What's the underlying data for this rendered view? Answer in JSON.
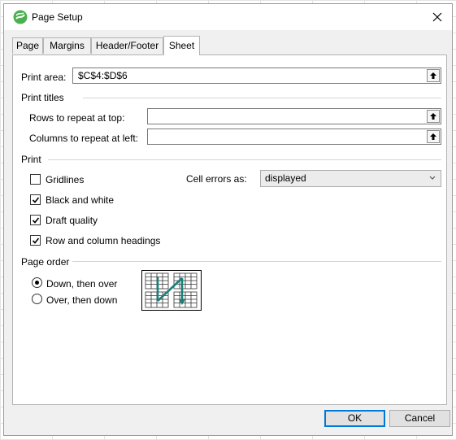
{
  "window": {
    "title": "Page Setup"
  },
  "tabs": [
    {
      "label": "Page",
      "active": false
    },
    {
      "label": "Margins",
      "active": false
    },
    {
      "label": "Header/Footer",
      "active": false
    },
    {
      "label": "Sheet",
      "active": true
    }
  ],
  "print_area": {
    "label": "Print area:",
    "value": "$C$4:$D$6"
  },
  "print_titles": {
    "heading": "Print titles",
    "rows_label": "Rows to repeat at top:",
    "rows_value": "",
    "columns_label": "Columns to repeat at left:",
    "columns_value": ""
  },
  "print": {
    "heading": "Print",
    "options": [
      {
        "label": "Gridlines",
        "checked": false
      },
      {
        "label": "Black and white",
        "checked": true
      },
      {
        "label": "Draft quality",
        "checked": true
      },
      {
        "label": "Row and column headings",
        "checked": true
      }
    ],
    "cell_errors_label": "Cell errors as:",
    "cell_errors_value": "displayed"
  },
  "page_order": {
    "heading": "Page order",
    "options": [
      {
        "label": "Down, then over",
        "selected": true
      },
      {
        "label": "Over, then down",
        "selected": false
      }
    ]
  },
  "buttons": {
    "ok": "OK",
    "cancel": "Cancel"
  },
  "colors": {
    "accent": "#0078d7",
    "arrow": "#1a7f7a",
    "logo": "#4caf50"
  },
  "icons": [
    "app-logo-icon",
    "close-icon",
    "collapse-dialog-icon",
    "checkmark-icon",
    "chevron-down-icon",
    "page-order-preview-icon"
  ]
}
